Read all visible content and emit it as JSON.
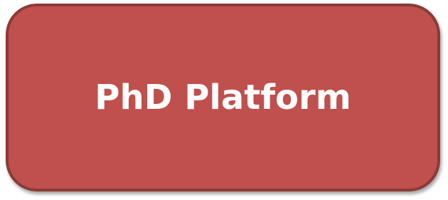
{
  "shape": {
    "label": "PhD Platform",
    "fill_color": "#c0504d",
    "border_color": "#8c3a38",
    "text_color": "#ffffff"
  }
}
